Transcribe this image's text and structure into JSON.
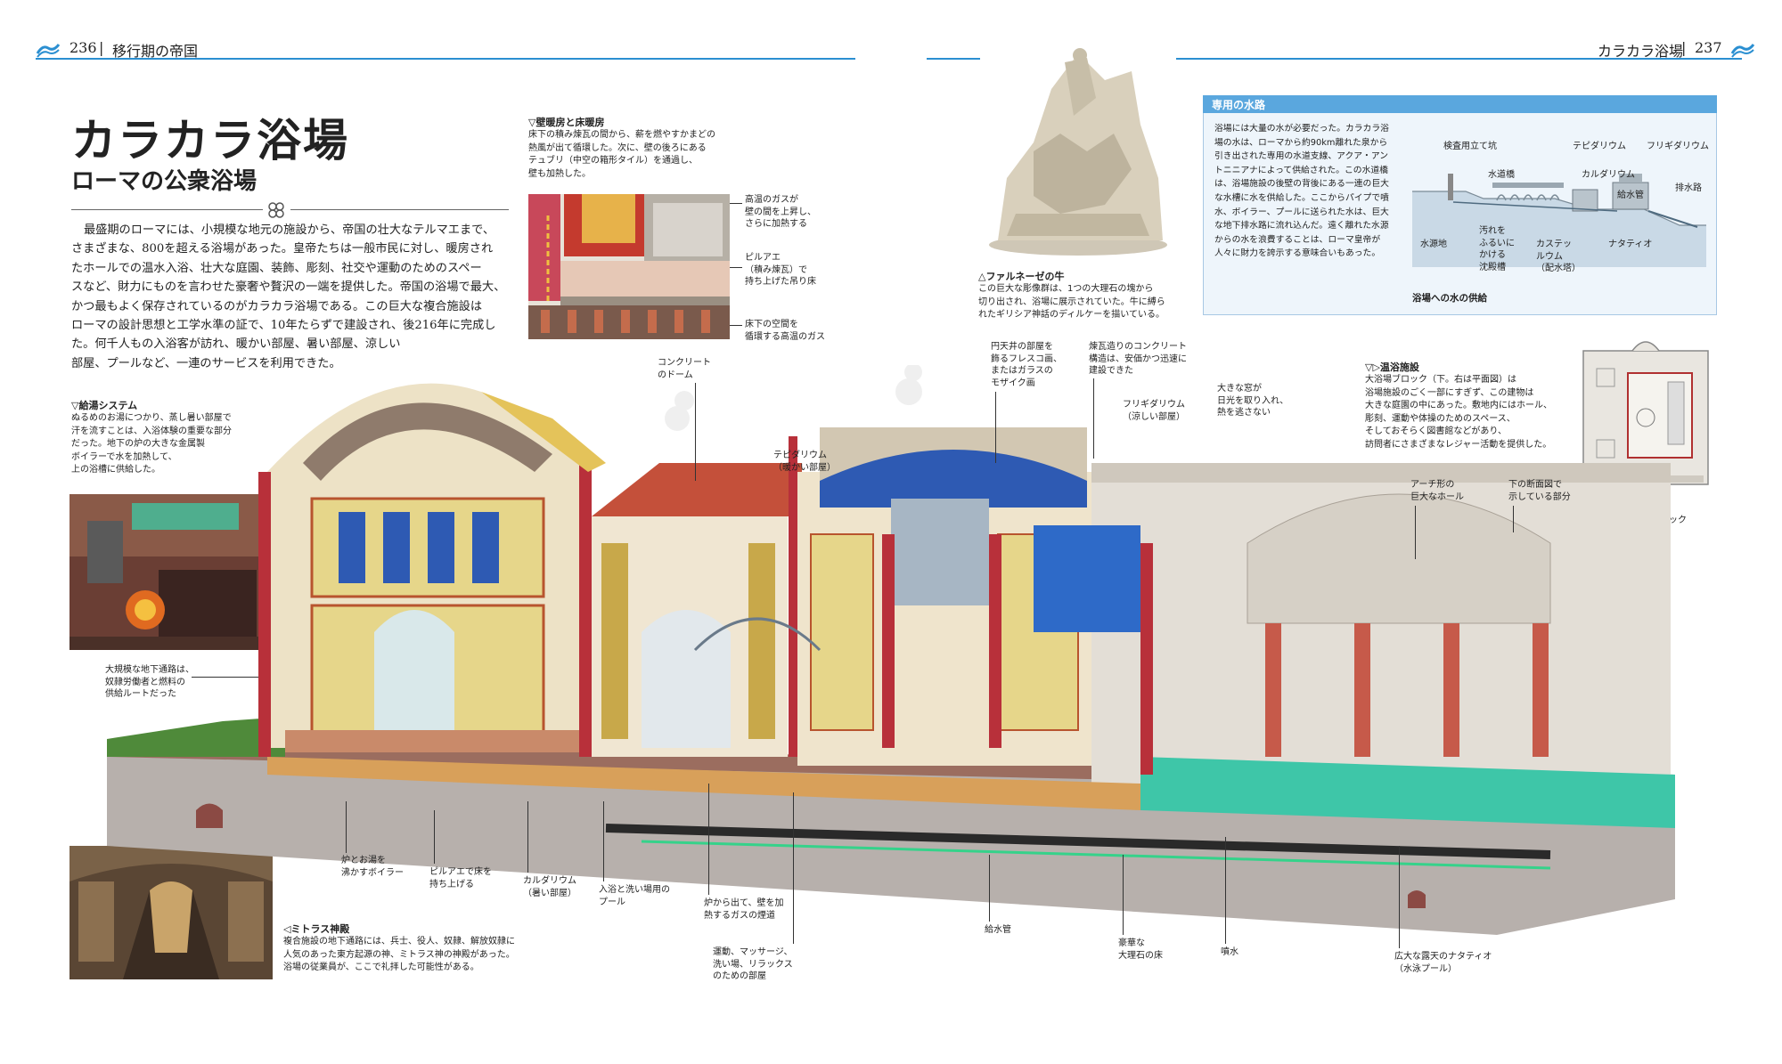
{
  "header": {
    "left_page": "236",
    "left_section": "移行期の帝国",
    "right_section": "カラカラ浴場",
    "right_page": "237",
    "accent_color": "#2b8fd1"
  },
  "title": "カラカラ浴場",
  "subtitle": "ローマの公衆浴場",
  "body": [
    "最盛期のローマには、小規模な地元の施設から、帝国の壮大なテルマエまで、",
    "さまざまな、800を超える浴場があった。皇帝たちは一般市民に対し、暖房され",
    "たホールでの温水入浴、壮大な庭園、装飾、彫刻、社交や運動のためのスペー",
    "スなど、財力にものを言わせた豪奢や贅沢の一端を提供した。帝国の浴場で最大、",
    "かつ最もよく保存されているのがカラカラ浴場である。この巨大な複合施設は",
    "ローマの設計思想と工学水準の証で、10年たらずで建設され、後216年に完成し",
    "た。何千人もの入浴客が訪れ、暖かい部屋、暑い部屋、涼しい",
    "部屋、プールなど、一連のサービスを利用できた。"
  ],
  "captions": {
    "heating": {
      "head": "▽壁暖房と床暖房",
      "lines": [
        "床下の積み煉瓦の間から、薪を燃やすかまどの",
        "熱風が出て循環した。次に、壁の後ろにある",
        "テュブリ（中空の箱形タイル）を通過し、",
        "壁も加熱した。"
      ]
    },
    "farnese": {
      "head": "△ファルネーゼの牛",
      "lines": [
        "この巨大な彫像群は、1つの大理石の塊から",
        "切り出され、浴場に展示されていた。牛に縛ら",
        "れたギリシア神話のディルケーを描いている。"
      ]
    },
    "hotwater": {
      "head": "▽給湯システム",
      "lines": [
        "ぬるめのお湯につかり、蒸し暑い部屋で",
        "汗を流すことは、入浴体験の重要な部分",
        "だった。地下の炉の大きな金属製",
        "ボイラーで水を加熱して、",
        "上の浴槽に供給した。"
      ]
    },
    "mithras": {
      "head": "◁ミトラス神殿",
      "lines": [
        "複合施設の地下通路には、兵士、役人、奴隷、解放奴隷に",
        "人気のあった東方起源の神、ミトラス神の神殿があった。",
        "浴場の従業員が、ここで礼拝した可能性がある。"
      ]
    },
    "facilities": {
      "head": "▽▷温浴施設",
      "lines": [
        "大浴場ブロック（下。右は平面図）は",
        "浴場施設のごく一部にすぎず、この建物は",
        "大きな庭園の中にあった。敷地内にはホール、",
        "彫刻、運動や体操のためのスペース、",
        "そしておそらく図書館などがあり、",
        "訪問者にさまざまなレジャー活動を提供した。"
      ]
    }
  },
  "aqueduct": {
    "heading": "専用の水路",
    "lines": [
      "浴場には大量の水が必要だった。カラカラ浴",
      "場の水は、ローマから約90km離れた泉から",
      "引き出された専用の水道支線、アクア・アン",
      "トニニアナによって供給された。この水道橋",
      "は、浴場施設の後壁の背後にある一連の巨大",
      "な水槽に水を供給した。ここからパイプで噴",
      "水、ボイラー、プールに送られた水は、巨大",
      "な地下排水路に流れ込んだ。遠く離れた水源",
      "からの水を浪費することは、ローマ皇帝が",
      "人々に財力を誇示する意味合いもあった。"
    ],
    "diagram_caption": "浴場への水の供給",
    "labels": {
      "shaft": "検査用立て坑",
      "tepidarium": "テピダリウム",
      "frigidarium": "フリギダリウム",
      "aqueduct": "水道橋",
      "caldarium": "カルダリウム",
      "drain": "排水路",
      "supply": "給水管",
      "source": "水源地",
      "settling": [
        "汚れを",
        "ふるいに",
        "かける",
        "沈殿槽"
      ],
      "cistern": [
        "カステッ",
        "ルウム",
        "（配水塔）"
      ],
      "natatio": "ナタティオ"
    }
  },
  "callouts": {
    "concrete_dome": [
      "コンクリート",
      "のドーム"
    ],
    "hot_gas": [
      "高温のガスが",
      "壁の間を上昇し、",
      "さらに加熱する"
    ],
    "pilae": [
      "ピルアエ",
      "（積み煉瓦）で",
      "持ち上げた吊り床"
    ],
    "underfloor": [
      "床下の空間を",
      "循環する高温のガス"
    ],
    "tepidarium": [
      "テピダリウム",
      "（暖かい部屋）"
    ],
    "fresco": [
      "円天井の部屋を",
      "飾るフレスコ画、",
      "またはガラスの",
      "モザイク画"
    ],
    "brick_concrete": [
      "煉瓦造りのコンクリート",
      "構造は、安価かつ迅速に",
      "建設できた"
    ],
    "frigidarium": [
      "フリギダリウム",
      "（涼しい部屋）"
    ],
    "windows": [
      "大きな窓が",
      "日光を取り入れ、",
      "熱を逃さない"
    ],
    "arch_hall": [
      "アーチ形の",
      "巨大なホール"
    ],
    "section_shown": [
      "下の断面図で",
      "示している部分"
    ],
    "great_block": "大浴場ブロック",
    "tunnel": [
      "大規模な地下通路は、",
      "奴隷労働者と燃料の",
      "供給ルートだった"
    ],
    "boiler": [
      "炉とお湯を",
      "沸かすボイラー"
    ],
    "pilae_raise": [
      "ピルアエで床を",
      "持ち上げる"
    ],
    "caldarium": [
      "カルダリウム",
      "（暑い部屋）"
    ],
    "pool_bath": [
      "入浴と洗い場用の",
      "プール"
    ],
    "flue": [
      "炉から出て、壁を加",
      "熱するガスの煙道"
    ],
    "exercise": [
      "運動、マッサージ、",
      "洗い場、リラックス",
      "のための部屋"
    ],
    "supply_pipe": "給水管",
    "marble_floor": [
      "豪華な",
      "大理石の床"
    ],
    "fountain": "噴水",
    "natatio": [
      "広大な露天のナタティオ",
      "（水泳プール）"
    ]
  }
}
